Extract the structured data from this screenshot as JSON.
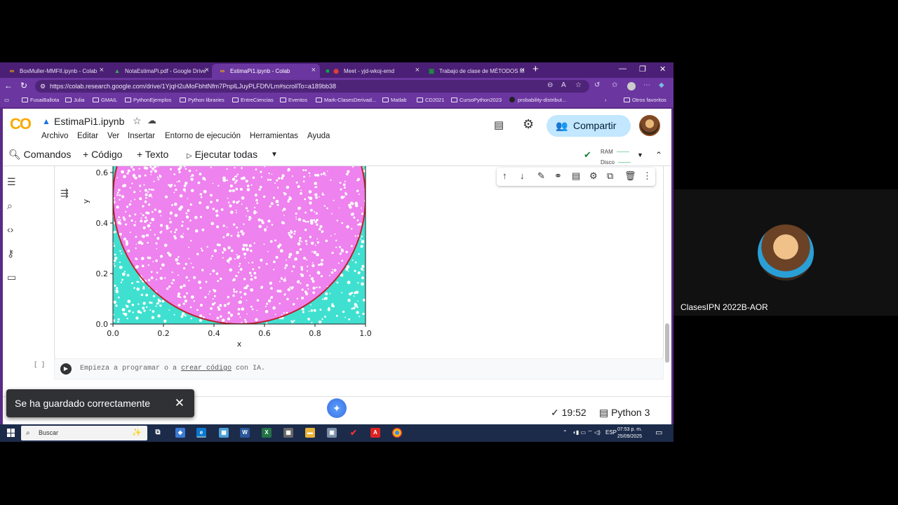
{
  "browser": {
    "tabs": [
      {
        "label": "BoxMuller-MMFII.ipynb - Colab",
        "fav": "co"
      },
      {
        "label": "NotaEstimaPi.pdf - Google Drive",
        "fav": "drive"
      },
      {
        "label": "EstimaPi1.ipynb - Colab",
        "fav": "co"
      },
      {
        "label": "Meet - yjd-wkoj-emd",
        "fav": "meet"
      },
      {
        "label": "Trabajo de clase de MÉTODOS M",
        "fav": "classroom"
      }
    ],
    "url": "https://colab.research.google.com/drive/1YjqH2uMoFbhtNfm7PnplLJuyPLFDfVLm#scrollTo=a189bb38",
    "bookmarks": [
      "FusaiBallota",
      "Julia",
      "GMAIL",
      "PythonEjemplos",
      "Python libraries",
      "EntreCiencias",
      "Eventos",
      "Mark-ClasesDerivad...",
      "Matlab",
      "CD2021",
      "CursoPython2023",
      "probability-distribut...",
      "Otros favoritos"
    ]
  },
  "colab": {
    "logo": "CO",
    "notebook_title": "EstimaPi1.ipynb",
    "menu": [
      "Archivo",
      "Editar",
      "Ver",
      "Insertar",
      "Entorno de ejecución",
      "Herramientas",
      "Ayuda"
    ],
    "share_label": "Compartir",
    "toolbar": {
      "commands": "Comandos",
      "add_code": "+ Código",
      "add_text": "+ Texto",
      "run_all": "Ejecutar todas",
      "ram": "RAM",
      "disk": "Disco"
    },
    "empty_cell": {
      "bracket": "[ ]",
      "prefix": "Empieza a programar o a ",
      "link": "crear código",
      "suffix": " con IA."
    },
    "status": {
      "time": "✓ 19:52",
      "kernel": "Python 3"
    },
    "toast": "Se ha guardado correctamente",
    "colors": {
      "accent": "#c2e7ff",
      "browser_frame": "#6b36a0"
    }
  },
  "chart_data": {
    "type": "scatter",
    "title": "",
    "xlabel": "x",
    "ylabel": "y",
    "xlim": [
      0.0,
      1.0
    ],
    "ylim_visible": [
      0.0,
      0.62
    ],
    "x_ticks": [
      "0.0",
      "0.2",
      "0.4",
      "0.6",
      "0.8",
      "1.0"
    ],
    "y_ticks": [
      "0.0",
      "0.2",
      "0.4",
      "0.6"
    ],
    "series": [
      {
        "color": "#ee82ee",
        "region": "inside"
      },
      {
        "color": "#40e0d0",
        "region": "outside"
      }
    ],
    "circle": {
      "center": [
        0.5,
        0.5
      ],
      "radius": 0.5,
      "color": "#c0202a"
    }
  },
  "taskbar": {
    "search_placeholder": "Buscar",
    "lang": "ESP",
    "time": "07:53 p. m.",
    "date": "25/09/2025"
  },
  "meet": {
    "participant_name": "ClasesIPN 2022B-AOR"
  }
}
